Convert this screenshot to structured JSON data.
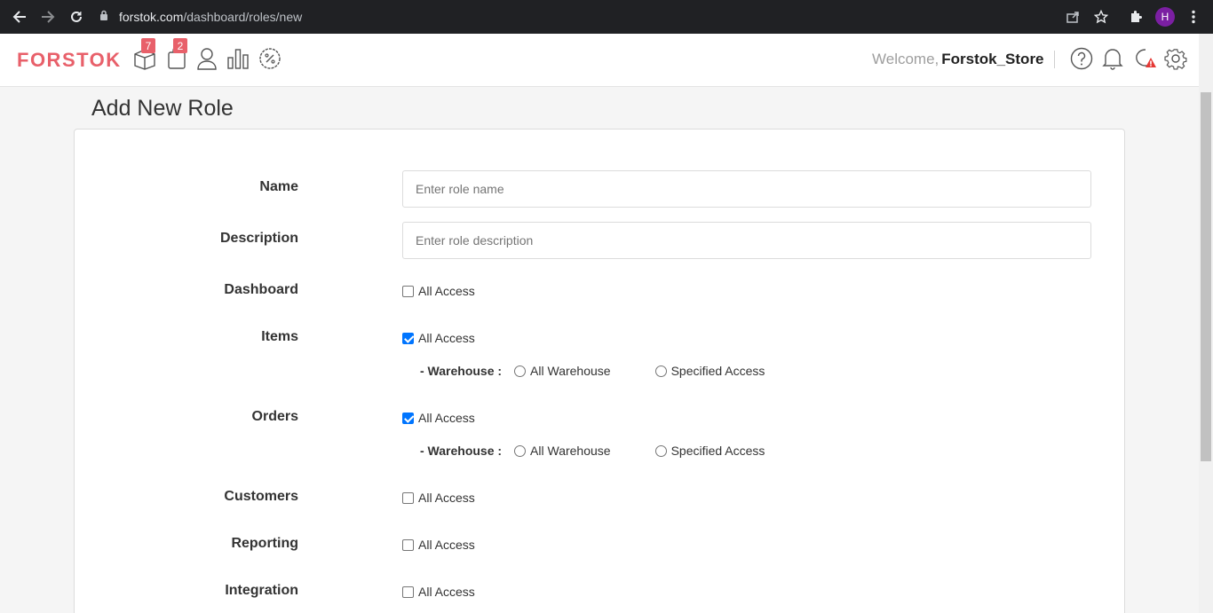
{
  "browser": {
    "url_host": "forstok.com",
    "url_path": "/dashboard/roles/new",
    "profile_initial": "H"
  },
  "header": {
    "logo": "FORSTOK",
    "items_badge": "7",
    "orders_badge": "2",
    "welcome": "Welcome,",
    "username": "Forstok_Store"
  },
  "page": {
    "title": "Add New Role"
  },
  "form": {
    "name_label": "Name",
    "name_placeholder": "Enter role name",
    "description_label": "Description",
    "description_placeholder": "Enter role description",
    "dashboard": {
      "label": "Dashboard",
      "option": "All Access",
      "checked": false
    },
    "items": {
      "label": "Items",
      "option": "All Access",
      "checked": true,
      "warehouse_label": "- Warehouse :",
      "warehouse_all": "All Warehouse",
      "warehouse_specified": "Specified Access"
    },
    "orders": {
      "label": "Orders",
      "option": "All Access",
      "checked": true,
      "warehouse_label": "- Warehouse :",
      "warehouse_all": "All Warehouse",
      "warehouse_specified": "Specified Access"
    },
    "customers": {
      "label": "Customers",
      "option": "All Access",
      "checked": false
    },
    "reporting": {
      "label": "Reporting",
      "option": "All Access",
      "checked": false
    },
    "integration": {
      "label": "Integration",
      "option": "All Access",
      "checked": false
    }
  },
  "colors": {
    "brand": "#e8606a",
    "checkbox_on": "#0075ff",
    "chrome_bg": "#202124"
  }
}
